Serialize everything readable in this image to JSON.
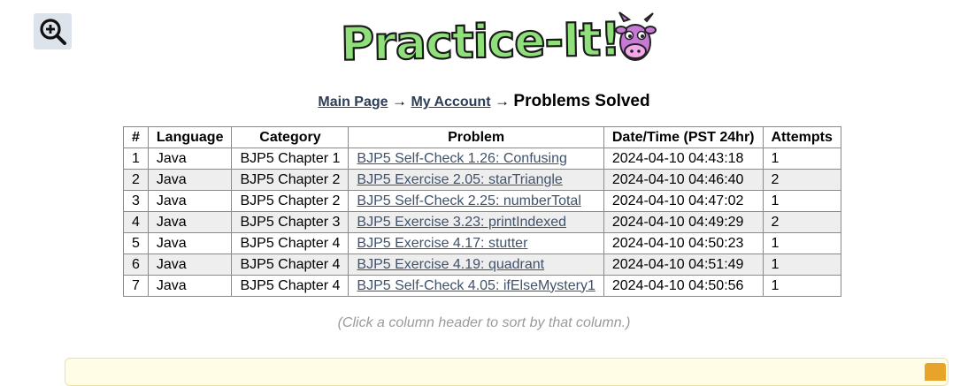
{
  "logo": {
    "text": "Practice-It!",
    "mascot": "cow-icon"
  },
  "zoom": {
    "icon": "zoom-in-icon"
  },
  "breadcrumb": {
    "main_page": "Main Page",
    "arrow": "→",
    "my_account": "My Account",
    "current": "Problems Solved"
  },
  "table": {
    "headers": [
      "#",
      "Language",
      "Category",
      "Problem",
      "Date/Time (PST 24hr)",
      "Attempts"
    ],
    "rows": [
      {
        "num": "1",
        "language": "Java",
        "category": "BJP5 Chapter 1",
        "problem": "BJP5 Self-Check 1.26: Confusing",
        "datetime": "2024-04-10 04:43:18",
        "attempts": "1"
      },
      {
        "num": "2",
        "language": "Java",
        "category": "BJP5 Chapter 2",
        "problem": "BJP5 Exercise 2.05: starTriangle",
        "datetime": "2024-04-10 04:46:40",
        "attempts": "2"
      },
      {
        "num": "3",
        "language": "Java",
        "category": "BJP5 Chapter 2",
        "problem": "BJP5 Self-Check 2.25: numberTotal",
        "datetime": "2024-04-10 04:47:02",
        "attempts": "1"
      },
      {
        "num": "4",
        "language": "Java",
        "category": "BJP5 Chapter 3",
        "problem": "BJP5 Exercise 3.23: printIndexed",
        "datetime": "2024-04-10 04:49:29",
        "attempts": "2"
      },
      {
        "num": "5",
        "language": "Java",
        "category": "BJP5 Chapter 4",
        "problem": "BJP5 Exercise 4.17: stutter",
        "datetime": "2024-04-10 04:50:23",
        "attempts": "1"
      },
      {
        "num": "6",
        "language": "Java",
        "category": "BJP5 Chapter 4",
        "problem": "BJP5 Exercise 4.19: quadrant",
        "datetime": "2024-04-10 04:51:49",
        "attempts": "1"
      },
      {
        "num": "7",
        "language": "Java",
        "category": "BJP5 Chapter 4",
        "problem": "BJP5 Self-Check 4.05: ifElseMystery1",
        "datetime": "2024-04-10 04:50:56",
        "attempts": "1"
      }
    ]
  },
  "hint": "(Click a column header to sort by that column.)",
  "colors": {
    "link": "#40526b",
    "logo_green": "#8fe07a",
    "mascot_purple": "#c879d6",
    "alt_row": "#eeeeee",
    "notice_bg": "#fffde6"
  }
}
